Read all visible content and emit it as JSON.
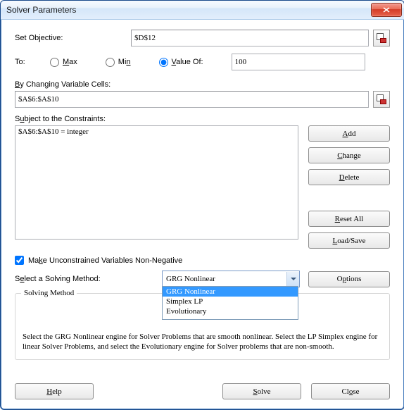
{
  "window": {
    "title": "Solver Parameters"
  },
  "objective": {
    "label": "Set Objective:",
    "value": "$D$12"
  },
  "to": {
    "label": "To:",
    "max": "Max",
    "min": "Min",
    "value_of": "Value Of:",
    "value_of_value": "100",
    "selected": "value_of"
  },
  "changing": {
    "label": "By Changing Variable Cells:",
    "value": "$A$6:$A$10"
  },
  "constraints": {
    "label": "Subject to the Constraints:",
    "items": [
      "$A$6:$A$10 = integer"
    ]
  },
  "side_buttons": {
    "add": "Add",
    "change": "Change",
    "delete": "Delete",
    "reset_all": "Reset All",
    "load_save": "Load/Save"
  },
  "unconstrained": {
    "label": "Make Unconstrained Variables Non-Negative",
    "checked": true
  },
  "method": {
    "label": "Select a Solving Method:",
    "selected": "GRG Nonlinear",
    "options": [
      "GRG Nonlinear",
      "Simplex LP",
      "Evolutionary"
    ],
    "options_btn": "Options"
  },
  "group": {
    "title": "Solving Method",
    "desc": "Select the GRG Nonlinear engine for Solver Problems that are smooth nonlinear. Select the LP Simplex engine for linear Solver Problems, and select the Evolutionary engine for Solver problems that are non-smooth."
  },
  "footer": {
    "help": "Help",
    "solve": "Solve",
    "close": "Close"
  }
}
